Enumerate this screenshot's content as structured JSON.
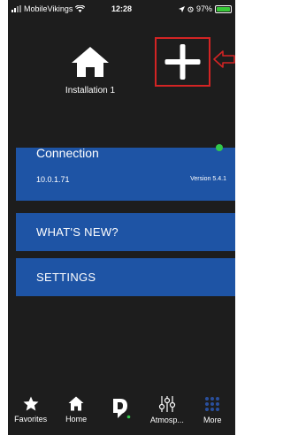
{
  "statusbar": {
    "carrier": "MobileVikings",
    "time": "12:28",
    "battery": "97%"
  },
  "header": {
    "installation_label": "Installation 1"
  },
  "connection": {
    "title": "Connection",
    "ip": "10.0.1.71",
    "version": "Version 5.4.1",
    "status_color": "#32c84b"
  },
  "menu": {
    "whats_new": "WHAT'S NEW?",
    "settings": "SETTINGS"
  },
  "tabs": [
    {
      "label": "Favorites",
      "icon": "star-icon"
    },
    {
      "label": "Home",
      "icon": "home-icon"
    },
    {
      "label": "",
      "icon": "logo-icon"
    },
    {
      "label": "Atmosp...",
      "icon": "sliders-icon"
    },
    {
      "label": "More",
      "icon": "grid-icon"
    }
  ],
  "colors": {
    "background": "#1d1d1d",
    "card": "#1e54a5",
    "highlight_box": "#d32424",
    "more_tab": "#2a4f9c"
  }
}
